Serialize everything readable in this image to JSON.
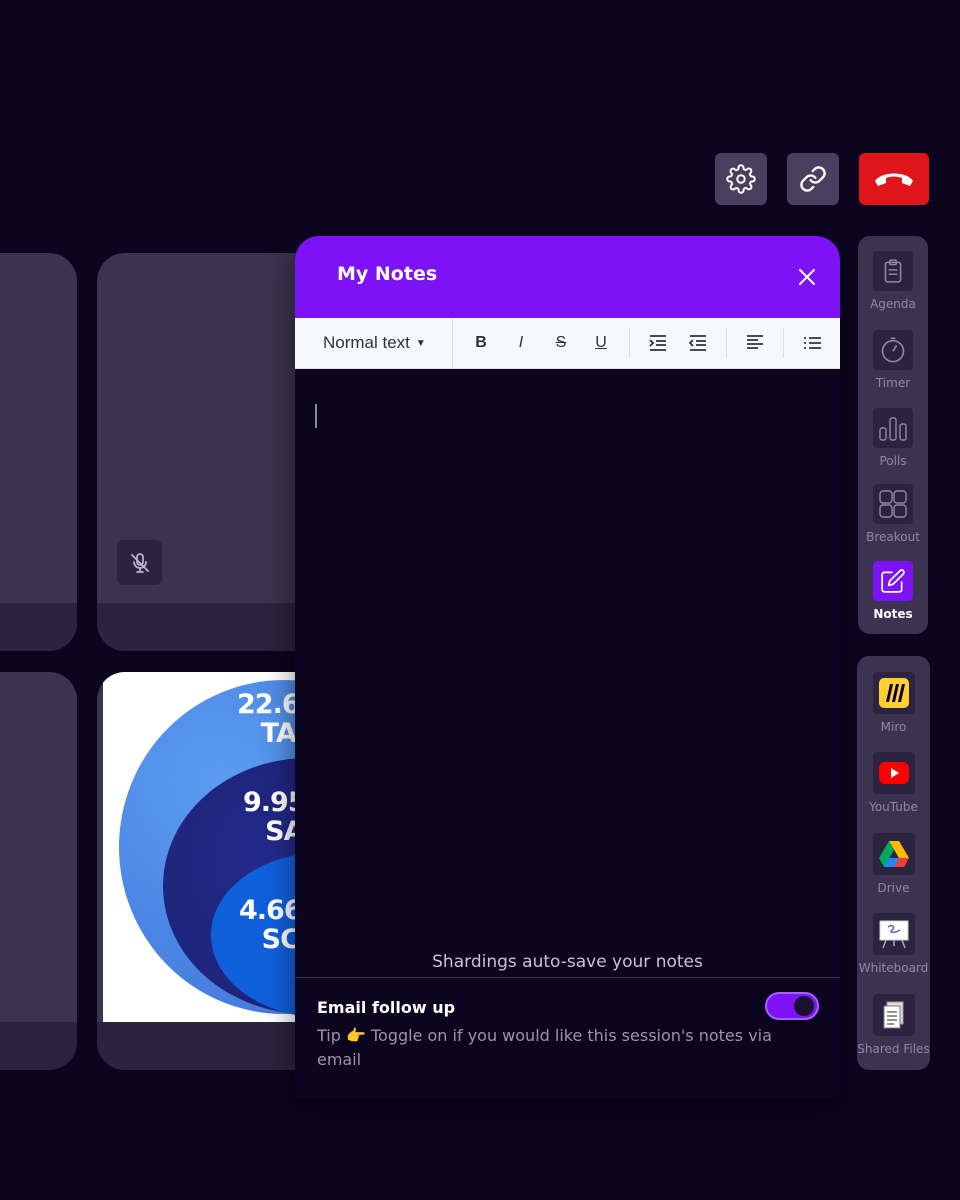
{
  "top_controls": {
    "settings_icon": "gear-icon",
    "link_icon": "link-icon",
    "end_call_icon": "phone-hangup-icon",
    "end_call_color": "#e0141b"
  },
  "shared_content": {
    "rings": [
      {
        "value": "22.6",
        "label": "TA"
      },
      {
        "value": "9.95",
        "label": "SA"
      },
      {
        "value": "4.66",
        "label": "SC"
      }
    ]
  },
  "notes": {
    "title": "My Notes",
    "toolbar": {
      "format_select": "Normal text",
      "buttons": [
        "B",
        "I",
        "S",
        "U"
      ]
    },
    "autosave_text": "Shardings auto-save your notes",
    "email_label": "Email follow up",
    "email_toggle_on": true,
    "tip_text": "Tip 👉 Toggle on if you would like this session's notes via email",
    "accent_color": "#7c12f5"
  },
  "rail_top": [
    {
      "label": "Agenda",
      "icon": "clipboard-icon",
      "active": false
    },
    {
      "label": "Timer",
      "icon": "stopwatch-icon",
      "active": false
    },
    {
      "label": "Polls",
      "icon": "bar-chart-icon",
      "active": false
    },
    {
      "label": "Breakout",
      "icon": "grid-icon",
      "active": false
    },
    {
      "label": "Notes",
      "icon": "edit-icon",
      "active": true
    }
  ],
  "rail_bottom": [
    {
      "label": "Miro",
      "icon": "miro-icon"
    },
    {
      "label": "YouTube",
      "icon": "youtube-icon"
    },
    {
      "label": "Drive",
      "icon": "drive-icon"
    },
    {
      "label": "Whiteboard",
      "icon": "whiteboard-icon"
    },
    {
      "label": "Shared Files",
      "icon": "files-icon"
    }
  ]
}
